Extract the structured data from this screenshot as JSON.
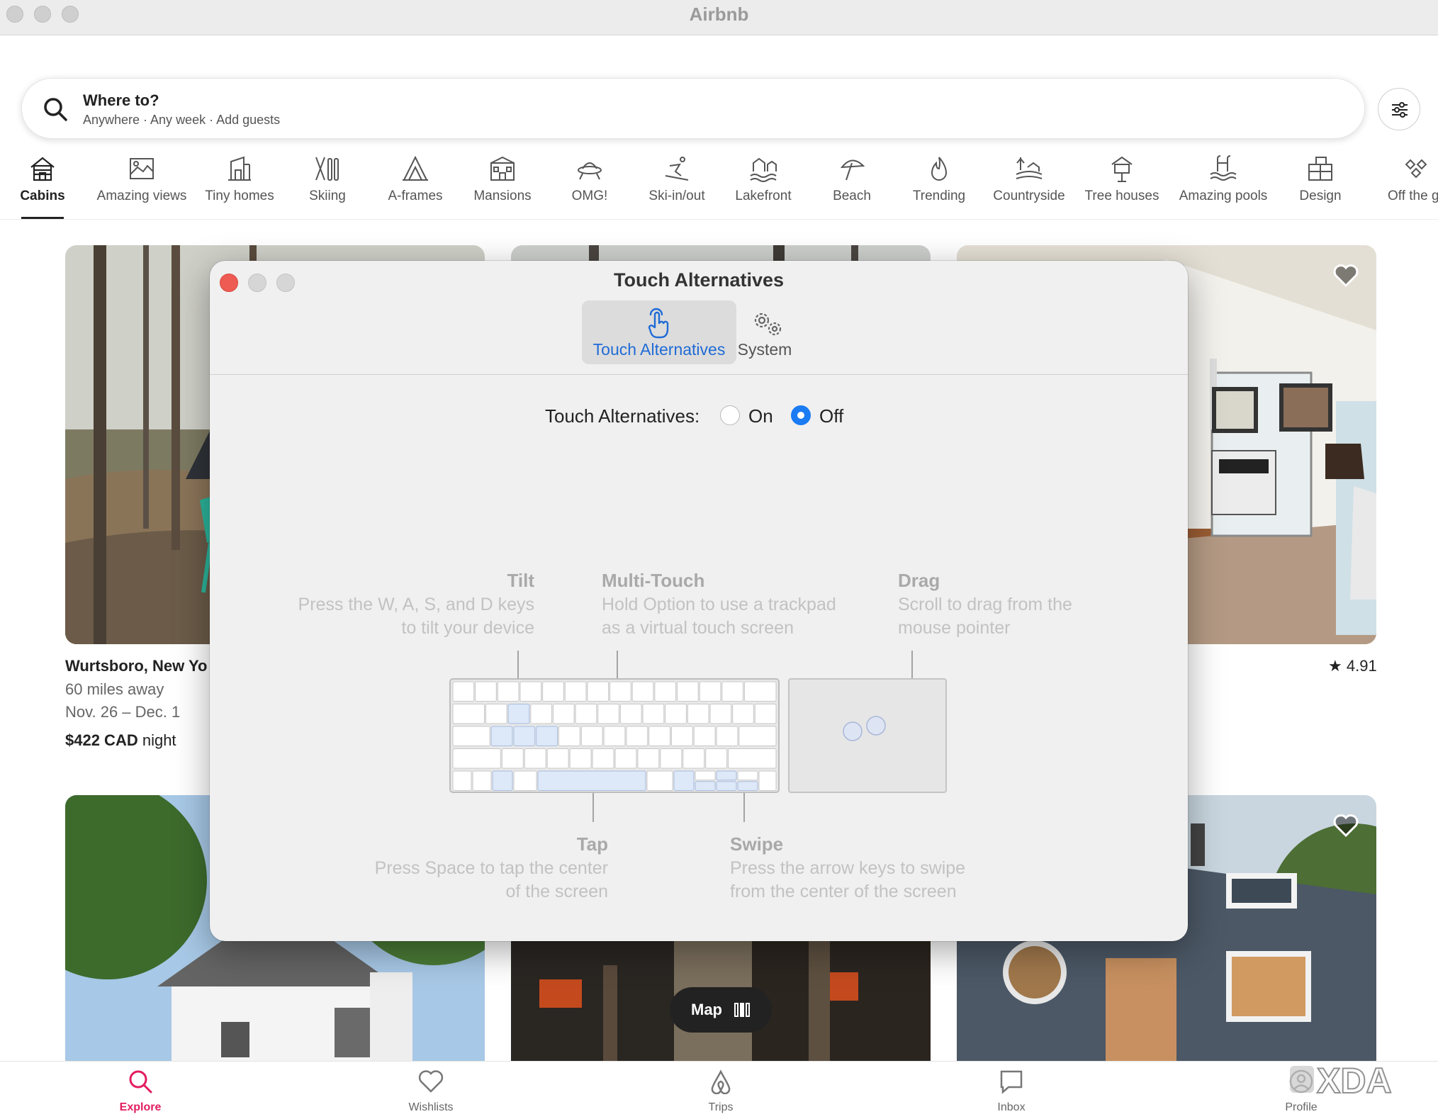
{
  "window": {
    "title": "Airbnb"
  },
  "search": {
    "title": "Where to?",
    "subtitle": "Anywhere · Any week · Add guests"
  },
  "categories": [
    {
      "label": "Cabins",
      "icon": "cabin-icon"
    },
    {
      "label": "Amazing views",
      "icon": "views-icon"
    },
    {
      "label": "Tiny homes",
      "icon": "tiny-home-icon"
    },
    {
      "label": "Skiing",
      "icon": "skiing-icon"
    },
    {
      "label": "A-frames",
      "icon": "a-frame-icon"
    },
    {
      "label": "Mansions",
      "icon": "mansion-icon"
    },
    {
      "label": "OMG!",
      "icon": "ufo-icon"
    },
    {
      "label": "Ski-in/out",
      "icon": "skier-icon"
    },
    {
      "label": "Lakefront",
      "icon": "lakefront-icon"
    },
    {
      "label": "Beach",
      "icon": "umbrella-icon"
    },
    {
      "label": "Trending",
      "icon": "flame-icon"
    },
    {
      "label": "Countryside",
      "icon": "countryside-icon"
    },
    {
      "label": "Tree houses",
      "icon": "treehouse-icon"
    },
    {
      "label": "Amazing pools",
      "icon": "pool-icon"
    },
    {
      "label": "Design",
      "icon": "design-icon"
    },
    {
      "label": "Off the grid",
      "icon": "off-grid-icon"
    }
  ],
  "listing": {
    "location": "Wurtsboro, New Yo",
    "distance": "60 miles away",
    "dates": "Nov. 26 – Dec. 1",
    "price": "$422 CAD",
    "price_unit": " night",
    "rating": "4.91"
  },
  "map_button": {
    "label": "Map"
  },
  "bottom_nav": [
    {
      "label": "Explore",
      "icon": "search-icon",
      "active": true
    },
    {
      "label": "Wishlists",
      "icon": "heart-icon"
    },
    {
      "label": "Trips",
      "icon": "airbnb-logo-icon"
    },
    {
      "label": "Inbox",
      "icon": "message-icon"
    },
    {
      "label": "Profile",
      "icon": "profile-icon"
    }
  ],
  "watermark": {
    "text": "XDA"
  },
  "dialog": {
    "title": "Touch Alternatives",
    "tabs": [
      {
        "label": "Touch Alternatives",
        "icon": "hand-pointer-icon",
        "active": true
      },
      {
        "label": "System",
        "icon": "gears-icon"
      }
    ],
    "setting_label": "Touch Alternatives:",
    "options": [
      "On",
      "Off"
    ],
    "selected": "Off",
    "hints": {
      "tilt": {
        "title": "Tilt",
        "line1": "Press the W, A, S, and D keys",
        "line2": "to tilt your device"
      },
      "multitouch": {
        "title": "Multi-Touch",
        "line1": "Hold Option to use a trackpad",
        "line2": "as a virtual touch screen"
      },
      "drag": {
        "title": "Drag",
        "line1": "Scroll to drag from the",
        "line2": "mouse pointer"
      },
      "tap": {
        "title": "Tap",
        "line1": "Press Space to tap the center",
        "line2": "of the screen"
      },
      "swipe": {
        "title": "Swipe",
        "line1": "Press the arrow keys to swipe",
        "line2": "from the center of the screen"
      }
    }
  },
  "colors": {
    "accent_red": "#e31c5f",
    "radio_blue": "#1a7bf3",
    "tab_blue": "#1f6bd6",
    "close_red": "#ee5b52"
  }
}
